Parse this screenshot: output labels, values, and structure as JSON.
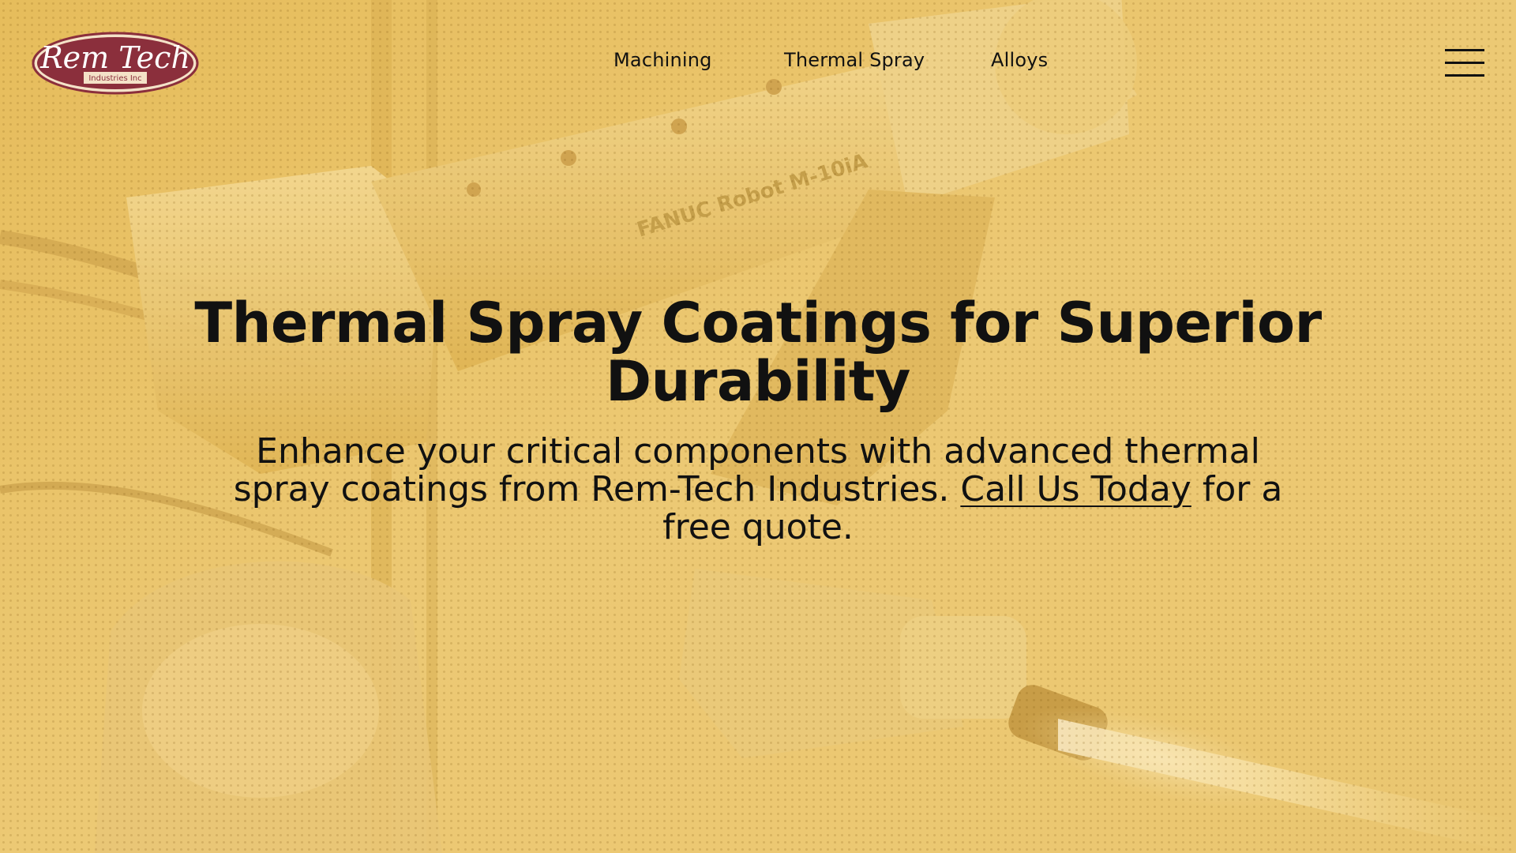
{
  "header": {
    "logo": {
      "text": "Rem Tech",
      "subtext": "Industries Inc",
      "colors": {
        "fill": "#8b2f3c",
        "text": "#ffffff"
      }
    },
    "nav": [
      {
        "label": "Machining"
      },
      {
        "label": "Thermal Spray"
      },
      {
        "label": "Alloys"
      }
    ],
    "menu_icon": "hamburger-menu-icon"
  },
  "hero": {
    "background_image": "robotic-thermal-spray-gun-photo",
    "robot_label": "FANUC Robot M-10iA",
    "headline": "Thermal Spray Coatings for Superior Durability",
    "subhead_before": "Enhance your critical components with advanced thermal spray coatings from Rem-Tech Industries. ",
    "cta_link": "Call Us Today",
    "subhead_after": " for a free quote.",
    "colors": {
      "tint": "#e6c26b",
      "text": "#111111"
    }
  }
}
